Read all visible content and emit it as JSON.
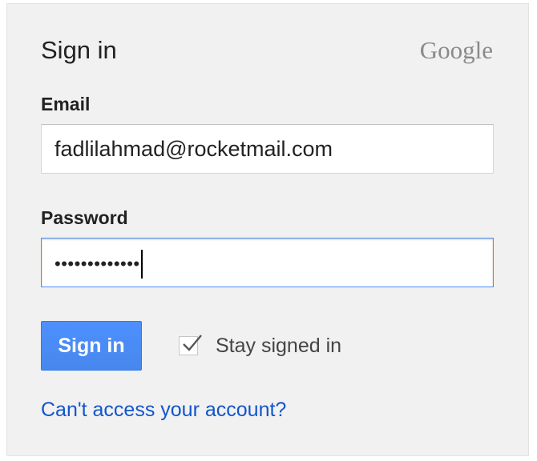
{
  "header": {
    "title": "Sign in",
    "brand": "Google"
  },
  "form": {
    "email_label": "Email",
    "email_value": "fadlilahmad@rocketmail.com",
    "password_label": "Password",
    "password_masked": "•••••••••••••",
    "signin_button": "Sign in",
    "stay_signed_in_label": "Stay signed in",
    "stay_signed_in_checked": true,
    "help_link": "Can't access your account?"
  },
  "colors": {
    "accent": "#4d90fe",
    "link": "#1155cc",
    "panel_bg": "#f1f1f1"
  }
}
